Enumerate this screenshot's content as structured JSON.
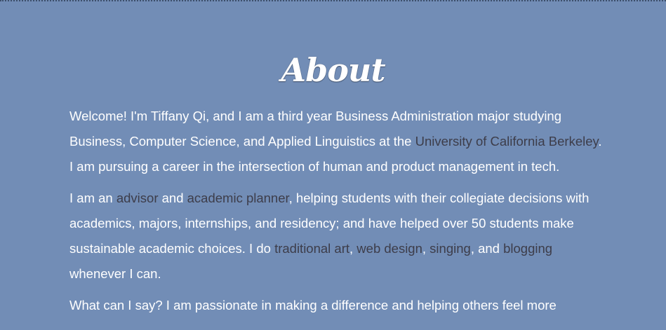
{
  "heading": "About",
  "paragraph1": {
    "text1": "Welcome! I'm Tiffany Qi, and I am a third year Business Administration major studying Business, Computer Science, and Applied Linguistics at the ",
    "link_university": "University of California Berkeley",
    "text2": ". I am pursuing a career in the intersection of human and product management in tech."
  },
  "paragraph2": {
    "text1": "I am an ",
    "link_advisor": "advisor",
    "text2": " and ",
    "link_planner": "academic planner",
    "text3": ", helping students with their collegiate decisions with academics, majors, internships, and residency; and have helped over 50 students make sustainable academic choices. I do ",
    "link_art": "traditional art",
    "sep1": ", ",
    "link_web": "web design",
    "sep2": ", ",
    "link_singing": "singing",
    "sep3": ", and ",
    "link_blogging": "blogging",
    "text4": " whenever I can."
  },
  "paragraph3": {
    "text1": "What can I say? I am passionate in making a difference and helping others feel more"
  },
  "colors": {
    "background": "#728db6",
    "text": "#ffffff",
    "link": "#3d3d4a"
  }
}
